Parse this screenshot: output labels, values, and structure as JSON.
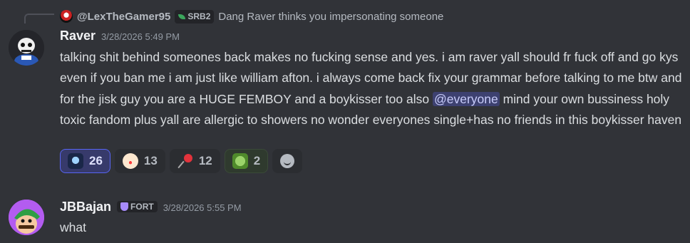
{
  "reply": {
    "username": "@LexTheGamer95",
    "tag": "SRB2",
    "text": "Dang Raver thinks you impersonating someone"
  },
  "message1": {
    "username": "Raver",
    "timestamp": "3/28/2026 5:49 PM",
    "text_before_mention": "talking shit behind someones back makes no fucking sense and yes. i am raver yall should fr fuck off and go kys even if you ban me i am just like william afton. i always come back fix your grammar before talking to me btw and for the jisk guy you are a HUGE FEMBOY and a boykisser too also ",
    "mention": "@everyone",
    "text_after_mention": " mind your own bussiness holy toxic fandom plus yall are allergic to showers no wonder everyones single+has no friends in this boykisser haven"
  },
  "reactions": [
    {
      "emoji": "skull-emoji",
      "count": "26",
      "active": true
    },
    {
      "emoji": "clown-emoji",
      "count": "13",
      "active": false
    },
    {
      "emoji": "pushpin-emoji",
      "count": "12",
      "active": false
    },
    {
      "emoji": "frog-emoji",
      "count": "2",
      "active": false
    }
  ],
  "message2": {
    "username": "JBBajan",
    "tag": "FORT",
    "timestamp": "3/28/2026 5:55 PM",
    "text": "what"
  },
  "colors": {
    "background": "#313338",
    "mention_bg": "#3c4270",
    "active_reaction": "#5865f2"
  }
}
